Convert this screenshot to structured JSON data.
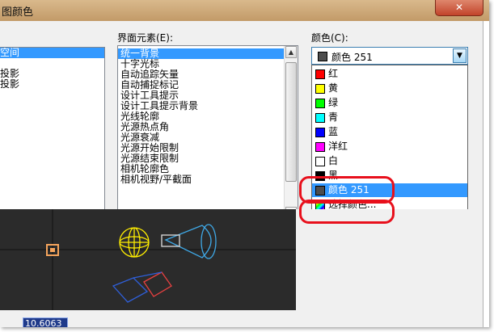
{
  "window": {
    "title_fragment": "图颜色",
    "close_label": "✕"
  },
  "context_list": {
    "items": [
      "空间",
      "",
      "投影",
      "投影"
    ],
    "selected_index": 0
  },
  "interface_elements": {
    "label": "界面元素(E):",
    "items": [
      "统一背景",
      "十字光标",
      "自动追踪矢量",
      "自动捕捉标记",
      "设计工具提示",
      "设计工具提示背景",
      "光线轮廓",
      "光源热点角",
      "光源衰减",
      "光源开始限制",
      "光源结束限制",
      "相机轮廓色",
      "相机视野/平截面"
    ],
    "selected_index": 0
  },
  "color": {
    "label": "颜色(C):",
    "selected": {
      "label": "颜色 251",
      "swatch": "#4d4d4d"
    },
    "options": [
      {
        "label": "红",
        "swatch": "#ff0000"
      },
      {
        "label": "黄",
        "swatch": "#ffff00"
      },
      {
        "label": "绿",
        "swatch": "#00ff00"
      },
      {
        "label": "青",
        "swatch": "#00ffff"
      },
      {
        "label": "蓝",
        "swatch": "#0000ff"
      },
      {
        "label": "洋红",
        "swatch": "#ff00ff"
      },
      {
        "label": "白",
        "swatch": "#ffffff"
      },
      {
        "label": "黑",
        "swatch": "#000000"
      },
      {
        "label": "颜色 251",
        "swatch": "#4d4d4d"
      },
      {
        "label": "选择颜色...",
        "swatch": "rainbow"
      }
    ],
    "highlighted_index": 8
  },
  "preview": {
    "coordinate_readout": "10.6063"
  },
  "colors": {
    "annotation": "#e8101c",
    "selection": "#3399ff",
    "preview_bg": "#2b2b2b"
  }
}
